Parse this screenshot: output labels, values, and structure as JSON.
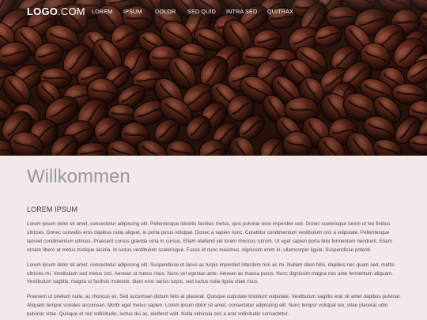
{
  "site": {
    "logo_bold": "LOGO",
    "logo_light": ".COM"
  },
  "nav": {
    "items": [
      "LOREM",
      "IPSUM",
      "DOLOR",
      "SED QUID",
      "INTRA SED",
      "QUITRAX"
    ]
  },
  "main": {
    "heading": "Willkommen",
    "section_title": "LOREM IPSUM",
    "paragraphs": [
      "Lorem ipsum dolor sit amet, consectetur adipiscing elit. Pellentesque lobortis facilisis metus, quis pulvinar eros imperdiet sed. Donec scelerisque lorem ut leo finibus ultricies. Donec convallis eros dapibus nulla aliquet, in porta purus volutpat. Donec a sapien nunc. Curabitur condimentum vestibulum orci a vulputate. Pellentesque laoreet condimentum ultrices. Praesent cursus gravida urna in cursus. Etiam eleifend vel lorem rhoncus rutrum. Ut eget sapien porta felis fermentum hendrerit. Etiam ornare libero at metus tristique lacinia. In luctus vestibulum scelerisque. Fusce id nunc maximus, dignissim enim in, ullamcorper ligula. Suspendisse potenti.",
      "Lorem ipsum dolor sit amet, consectetur adipiscing elit. Suspendisse et lacus ac turpis imperdiet interdum non ac mi. Nullam diam felis, dapibus nec quam sed, mattis ultricies mi. Vestibulum sed metus orci. Aenean ut metus risus. Nunc vel egestas ante. Aenean ac massa purus. Nunc dignissim magna nec ante fermentum aliquam. Vestibulum sagittis, magna ut facilisis molestie, diam eros varius turpis, sed luctus nulla ligula vitae risus.",
      "Praesent ut pretium nulla, ac rhoncus ex. Sed accumsan dictum felis at placerat. Quisque vulputate tincidunt vulputate. Vestibulum sagittis erat sit amet dapibus pulvinar. Aliquam tempor sodales accumsan. Morbi eget metus sapien. Lorem ipsum dolor sit amet, consectetur adipiscing elit. Nunc tempor volutpat leo, vitae placerat odio pulvinar vitae. Quisque et nisl sollicitudin, luctus dui ac, eleifend velit. Nulla vehicula orci a erat sollicitudin consectetur."
    ]
  },
  "colors": {
    "page_background": "#f3e9e9",
    "hero_background": "#2a140c",
    "heading": "#9a9a9a",
    "body_text": "#4c4c4c",
    "nav_text": "#ffffff"
  }
}
